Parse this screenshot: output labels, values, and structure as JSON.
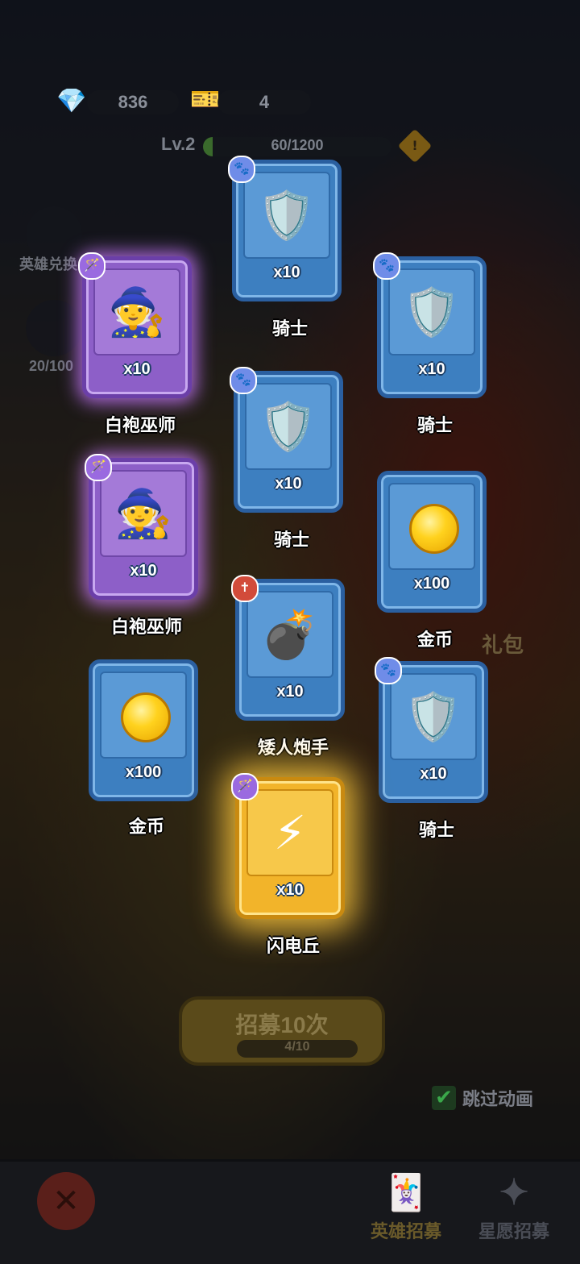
{
  "resources": {
    "gems": "836",
    "tickets": "4"
  },
  "level": {
    "label": "Lv.2",
    "xp": "60/1200",
    "xp_fraction": 0.05
  },
  "side": {
    "hero_exchange": "英雄兑换",
    "star_progress": "20/100"
  },
  "cards": [
    {
      "name": "骑士",
      "qty": "x10",
      "rarity": "blue",
      "badge": "paw",
      "icon": "knight"
    },
    {
      "name": "白袍巫师",
      "qty": "x10",
      "rarity": "purple",
      "badge": "wand",
      "icon": "wizard"
    },
    {
      "name": "骑士",
      "qty": "x10",
      "rarity": "blue",
      "badge": "paw",
      "icon": "knight"
    },
    {
      "name": "骑士",
      "qty": "x10",
      "rarity": "blue",
      "badge": "paw",
      "icon": "knight"
    },
    {
      "name": "白袍巫师",
      "qty": "x10",
      "rarity": "purple",
      "badge": "wand",
      "icon": "wizard"
    },
    {
      "name": "金币",
      "qty": "x100",
      "rarity": "blue",
      "badge": "",
      "icon": "coin"
    },
    {
      "name": "矮人炮手",
      "qty": "x10",
      "rarity": "blue",
      "badge": "cross",
      "icon": "dwarf"
    },
    {
      "name": "金币",
      "qty": "x100",
      "rarity": "blue",
      "badge": "",
      "icon": "coin"
    },
    {
      "name": "骑士",
      "qty": "x10",
      "rarity": "blue",
      "badge": "paw",
      "icon": "knight"
    },
    {
      "name": "闪电丘",
      "qty": "x10",
      "rarity": "gold",
      "badge": "wand",
      "icon": "lightning-hero"
    }
  ],
  "gift_label": "礼包",
  "recruit": {
    "label": "招募10次",
    "count": "4/10"
  },
  "skip_animation": "跳过动画",
  "tabs": {
    "hero_recruit": "英雄招募",
    "wish_recruit": "星愿招募"
  }
}
